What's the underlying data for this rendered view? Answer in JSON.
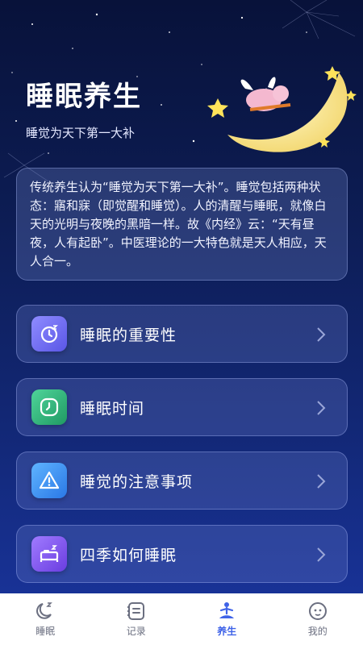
{
  "header": {
    "title": "睡眠养生",
    "subtitle": "睡觉为天下第一大补"
  },
  "intro": {
    "text": "传统养生认为“睡觉为天下第一大补”。睡觉包括两种状态：寤和寐（即觉醒和睡觉）。人的清醒与睡眠，就像白天的光明与夜晚的黑暗一样。故《内经》云：“天有昼夜，人有起卧”。中医理论的一大特色就是天人相应，天人合一。"
  },
  "menu": [
    {
      "label": "睡眠的重要性",
      "icon": "moon-clock-icon",
      "color": "#6f6cf2"
    },
    {
      "label": "睡眠时间",
      "icon": "clock-icon",
      "color": "#2fb57a"
    },
    {
      "label": "睡觉的注意事项",
      "icon": "warning-icon",
      "color": "#2f8ff0"
    },
    {
      "label": "四季如何睡眠",
      "icon": "bed-icon",
      "color": "#7a4ef0"
    }
  ],
  "tabbar": {
    "items": [
      {
        "label": "睡眠",
        "icon": "sleep-moon-icon"
      },
      {
        "label": "记录",
        "icon": "record-list-icon"
      },
      {
        "label": "养生",
        "icon": "meditation-icon",
        "active": true
      },
      {
        "label": "我的",
        "icon": "profile-face-icon"
      }
    ],
    "active_color": "#3f63e8"
  }
}
